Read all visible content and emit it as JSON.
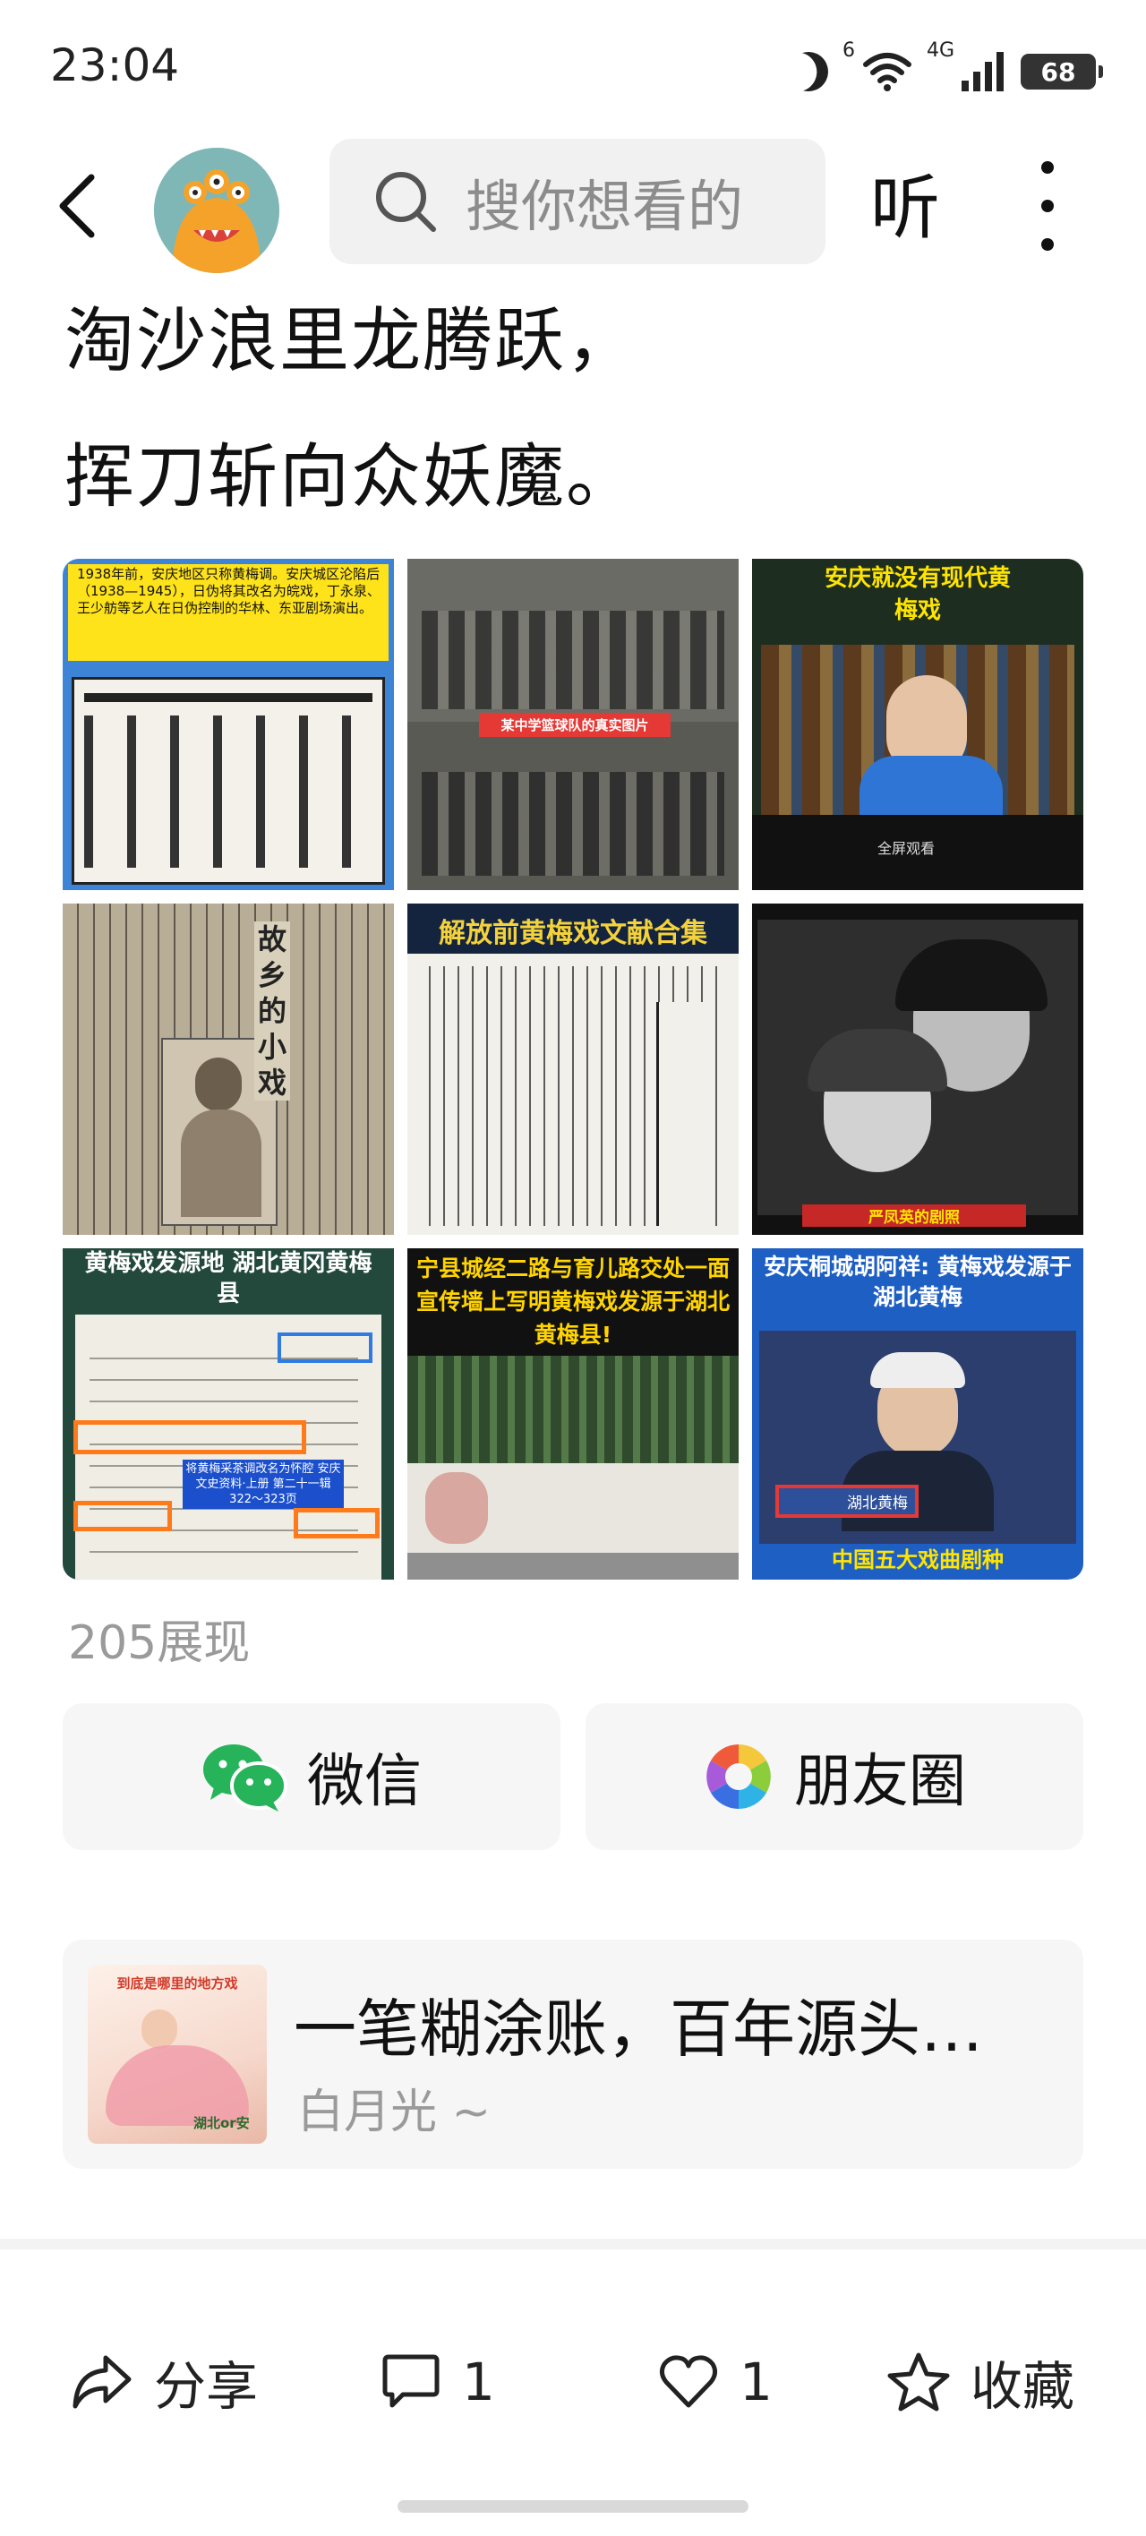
{
  "status": {
    "time": "23:04",
    "wifi_label": "6",
    "signal_label": "4G",
    "battery": "68"
  },
  "header": {
    "search_placeholder": "搜你想看的",
    "listen_label": "听"
  },
  "poem": [
    "淘沙浪里龙腾跃，",
    "挥刀斩向众妖魔。"
  ],
  "images": [
    {
      "caption": "1938年前，安庆地区只称黄梅调。安庆城区沦陷后（1938—1945），日伪将其改名为皖戏，丁永泉、王少舫等艺人在日伪控制的华林、东亚剧场演出。"
    },
    {
      "caption": "某中学篮球队的真实图片"
    },
    {
      "caption": "安庆就没有现代黄梅戏",
      "sub": "全屏观看"
    },
    {
      "caption": "故乡的小戏"
    },
    {
      "caption": "解放前黄梅戏文献合集"
    },
    {
      "caption": "严凤英的剧照"
    },
    {
      "caption": "黄梅戏发源地 湖北黄冈黄梅县",
      "note": "将黄梅采茶调改名为怀腔 安庆文史资料·上册 第二十一辑 322～323页"
    },
    {
      "caption": "宁县城经二路与育儿路交处一面宣传墙上写明黄梅戏发源于湖北黄梅县!"
    },
    {
      "caption": "安庆桐城胡阿祥: 黄梅戏发源于湖北黄梅",
      "footer": "中国五大戏曲剧种",
      "badge": "湖北黄梅"
    }
  ],
  "impressions": "205展现",
  "share": {
    "wechat": "微信",
    "moments": "朋友圈"
  },
  "related": {
    "title": "一笔糊涂账，百年源头…",
    "author": "白月光 ~",
    "thumb_caption": "到底是哪里的地方戏",
    "thumb_tag": "湖北or安"
  },
  "actions": {
    "share": "分享",
    "comment_count": "1",
    "like_count": "1",
    "collect": "收藏"
  }
}
